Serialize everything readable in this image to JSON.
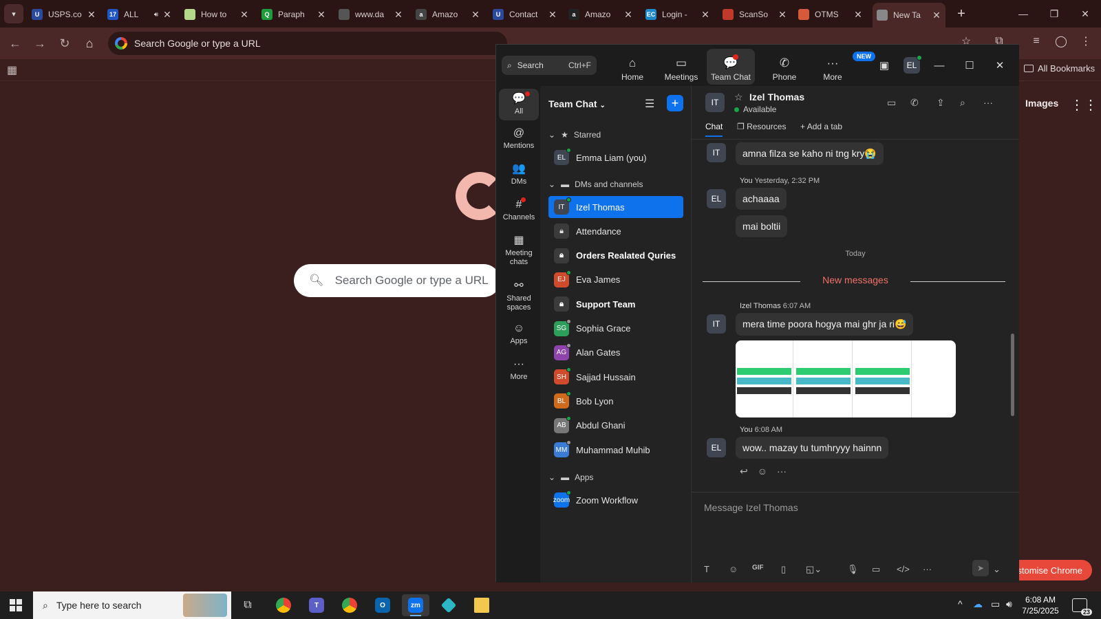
{
  "browser": {
    "tabs": [
      {
        "title": "USPS.co",
        "icon": "usps-icon",
        "color": "#2b4a9c",
        "glyph": "U"
      },
      {
        "title": "ALL",
        "icon": "seventeen-track-icon",
        "color": "#1f56c4",
        "glyph": "17",
        "audio": true
      },
      {
        "title": "How to",
        "icon": "chatgpt-icon",
        "color": "#b5d98c",
        "glyph": ""
      },
      {
        "title": "Paraph",
        "icon": "paraphrase-icon",
        "color": "#1e9b3e",
        "glyph": "Q"
      },
      {
        "title": "www.da",
        "icon": "globe-icon",
        "color": "#555555",
        "glyph": ""
      },
      {
        "title": "Amazo",
        "icon": "amazon-icon",
        "color": "#444444",
        "glyph": "a"
      },
      {
        "title": "Contact",
        "icon": "contact-icon",
        "color": "#2b4a9c",
        "glyph": "U"
      },
      {
        "title": "Amazo",
        "icon": "amazon-icon",
        "color": "#222222",
        "glyph": "a"
      },
      {
        "title": "Login -",
        "icon": "ec-icon",
        "color": "#1e88c8",
        "glyph": "EC"
      },
      {
        "title": "ScanSo",
        "icon": "scanso-icon",
        "color": "#c0392b",
        "glyph": ""
      },
      {
        "title": "OTMS",
        "icon": "otms-icon",
        "color": "#d65a3a",
        "glyph": ""
      },
      {
        "title": "New Ta",
        "icon": "chrome-icon",
        "color": "#888888",
        "glyph": ""
      }
    ],
    "omnibox_placeholder": "Search Google or type a URL",
    "all_bookmarks": "All Bookmarks",
    "images_link": "Images",
    "ntp_search_placeholder": "Search Google or type a URL",
    "customise_label": "Customise Chrome"
  },
  "zoom": {
    "search_label": "Search",
    "search_shortcut": "Ctrl+F",
    "nav": [
      {
        "label": "Home",
        "icon": "home-icon",
        "glyph": "⌂"
      },
      {
        "label": "Meetings",
        "icon": "video-icon",
        "glyph": "▭"
      },
      {
        "label": "Team Chat",
        "icon": "chat-bubble-icon",
        "glyph": "💬",
        "active": true,
        "dot": true
      },
      {
        "label": "Phone",
        "icon": "phone-icon",
        "glyph": "✆"
      },
      {
        "label": "More",
        "icon": "more-dots-icon",
        "glyph": "···"
      }
    ],
    "new_badge": "NEW",
    "user_initials": "EL",
    "rail": [
      {
        "label": "All",
        "icon": "chat-icon",
        "glyph": "💬",
        "active": true,
        "dot": true
      },
      {
        "label": "Mentions",
        "icon": "at-icon",
        "glyph": "@"
      },
      {
        "label": "DMs",
        "icon": "people-icon",
        "glyph": "👥"
      },
      {
        "label": "Channels",
        "icon": "hash-icon",
        "glyph": "#",
        "dot": true
      },
      {
        "label": "Meeting chats",
        "icon": "calendar-icon",
        "glyph": "▦"
      },
      {
        "label": "Shared spaces",
        "icon": "share-icon",
        "glyph": "⚯"
      },
      {
        "label": "Apps",
        "icon": "apps-chat-icon",
        "glyph": "☺"
      },
      {
        "label": "More",
        "icon": "ellipsis-icon",
        "glyph": "···"
      }
    ],
    "list_title": "Team Chat",
    "sections": {
      "starred": "Starred",
      "dms": "DMs and channels",
      "apps": "Apps"
    },
    "starred": [
      {
        "name": "Emma Liam (you)",
        "initials": "EL",
        "color": "#3f4652",
        "presence": "#19a64a"
      }
    ],
    "dms": [
      {
        "name": "Izel Thomas",
        "initials": "IT",
        "color": "#3f4652",
        "presence": "#19a64a",
        "selected": true
      },
      {
        "name": "Attendance",
        "type": "channel"
      },
      {
        "name": "Orders Realated Quries",
        "type": "channel",
        "bold": true
      },
      {
        "name": "Eva James",
        "initials": "EJ",
        "color": "#d04a2c",
        "presence": "#19a64a"
      },
      {
        "name": "Support Team",
        "type": "channel",
        "bold": true
      },
      {
        "name": "Sophia Grace",
        "initials": "SG",
        "color": "#2e9e5b",
        "presence": "#9a9a9a"
      },
      {
        "name": "Alan Gates",
        "initials": "AG",
        "color": "#8e44ad",
        "presence": "#9a9a9a"
      },
      {
        "name": "Sajjad Hussain",
        "initials": "SH",
        "color": "#d04a2c",
        "presence": "#19a64a"
      },
      {
        "name": "Bob Lyon",
        "initials": "BL",
        "color": "#d06a1c",
        "presence": "#19a64a"
      },
      {
        "name": "Abdul Ghani",
        "initials": "AB",
        "color": "#777777",
        "presence": "#19a64a"
      },
      {
        "name": "Muhammad Muhib",
        "initials": "MM",
        "color": "#3a7bd5",
        "presence": "#9a9a9a"
      }
    ],
    "apps": [
      {
        "name": "Zoom Workflow",
        "initials": "zoom",
        "color": "#0e72ed",
        "presence": "#19a64a"
      }
    ],
    "chat": {
      "contact_initials": "IT",
      "contact_name": "Izel Thomas",
      "contact_status": "Available",
      "tabs": [
        "Chat",
        "Resources",
        "Add a tab"
      ],
      "messages": {
        "m1": "amna filza se kaho ni tng kry😭",
        "you_meta_1": "You",
        "you_time_1": "Yesterday, 2:32 PM",
        "m2": "achaaaa",
        "m3": "mai boltii",
        "today": "Today",
        "new_messages": "New messages",
        "izel_meta": "Izel Thomas",
        "izel_time": "6:07 AM",
        "m4": "mera time poora hogya mai ghr ja ri😅",
        "you_meta_2": "You",
        "you_time_2": "6:08 AM",
        "m5": "wow.. mazay tu tumhryyy hainnn",
        "initials_izel": "IT",
        "initials_you": "EL"
      },
      "composer_placeholder": "Message Izel Thomas"
    }
  },
  "taskbar": {
    "search_placeholder": "Type here to search",
    "time": "6:08 AM",
    "date": "7/25/2025",
    "notifications": "23"
  }
}
